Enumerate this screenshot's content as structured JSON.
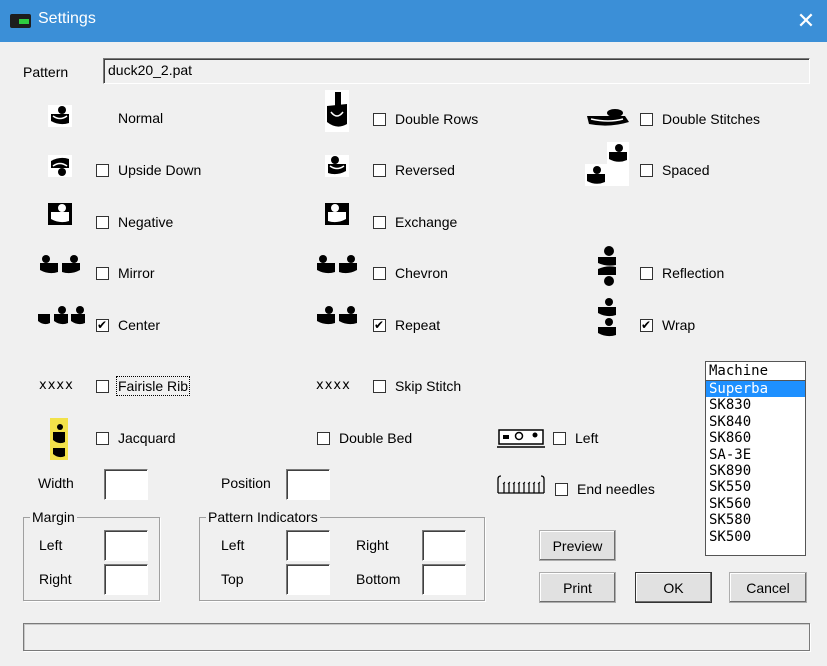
{
  "window": {
    "title": "Settings",
    "close": "✕"
  },
  "pattern": {
    "label": "Pattern",
    "value": "duck20_2.pat"
  },
  "options": {
    "normal": "Normal",
    "double_rows": {
      "label": "Double Rows",
      "checked": false
    },
    "double_stitches": {
      "label": "Double Stitches",
      "checked": false
    },
    "upside_down": {
      "label": "Upside Down",
      "checked": false
    },
    "reversed": {
      "label": "Reversed",
      "checked": false
    },
    "spaced": {
      "label": "Spaced",
      "checked": false
    },
    "negative": {
      "label": "Negative",
      "checked": false
    },
    "exchange": {
      "label": "Exchange",
      "checked": false
    },
    "mirror": {
      "label": "Mirror",
      "checked": false
    },
    "chevron": {
      "label": "Chevron",
      "checked": false
    },
    "reflection": {
      "label": "Reflection",
      "checked": false
    },
    "center": {
      "label": "Center",
      "checked": true
    },
    "repeat": {
      "label": "Repeat",
      "checked": true
    },
    "wrap": {
      "label": "Wrap",
      "checked": true
    },
    "fairisle_rib": {
      "label": "Fairisle Rib",
      "checked": false,
      "glyph": "xxxx"
    },
    "skip_stitch": {
      "label": "Skip Stitch",
      "checked": false,
      "glyph": "xxxx"
    },
    "jacquard": {
      "label": "Jacquard",
      "checked": false
    },
    "double_bed": {
      "label": "Double Bed",
      "checked": false
    },
    "left_carriage": {
      "label": "Left",
      "checked": false
    },
    "end_needles": {
      "label": "End needles",
      "checked": false
    }
  },
  "fields": {
    "width_label": "Width",
    "position_label": "Position"
  },
  "margin": {
    "title": "Margin",
    "left": "Left",
    "right": "Right"
  },
  "indicators": {
    "title": "Pattern Indicators",
    "left": "Left",
    "right": "Right",
    "top": "Top",
    "bottom": "Bottom"
  },
  "machine": {
    "header": "Machine",
    "items": [
      "Superba",
      "SK830",
      "SK840",
      "SK860",
      "SA-3E",
      "SK890",
      "SK550",
      "SK560",
      "SK580",
      "SK500"
    ],
    "selected": "Superba"
  },
  "buttons": {
    "preview": "Preview",
    "print": "Print",
    "ok": "OK",
    "cancel": "Cancel"
  },
  "colors": {
    "titlebar": "#3b8fd7",
    "selection": "#1e90ff",
    "jacquard_bg": "#f2e24a"
  }
}
